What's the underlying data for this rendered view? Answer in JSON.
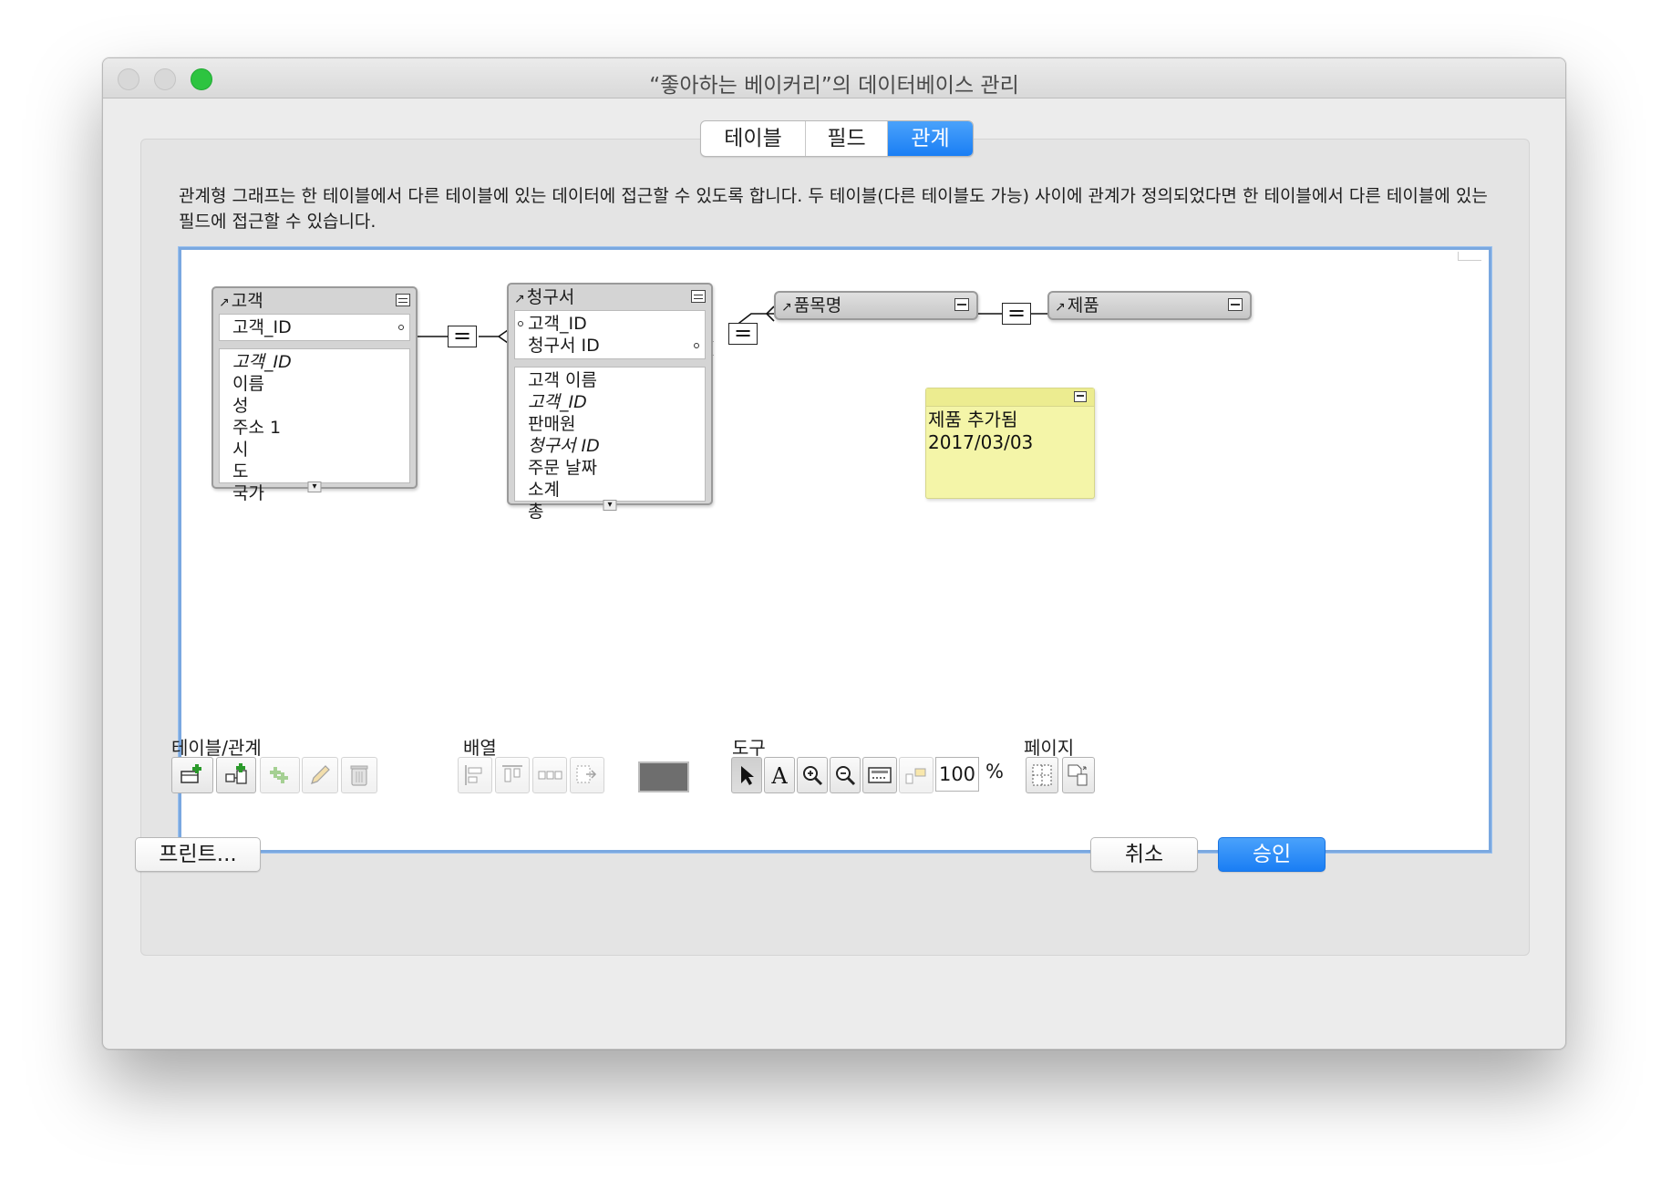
{
  "window": {
    "title": "“좋아하는 베이커리”의 데이터베이스 관리"
  },
  "tabs": [
    {
      "label": "테이블",
      "selected": false
    },
    {
      "label": "필드",
      "selected": false
    },
    {
      "label": "관계",
      "selected": true
    }
  ],
  "description": "관계형 그래프는 한 테이블에서 다른 테이블에 있는 데이터에 접근할 수 있도록 합니다. 두 테이블(다른 테이블도 가능) 사이에 관계가 정의되었다면 한 테이블에서 다른 테이블에 있는 필드에 접근할 수 있습니다.",
  "graph": {
    "tables": [
      {
        "name": "고객",
        "key_fields": [
          "고객_ID"
        ],
        "fields": [
          {
            "label": "고객_ID",
            "italic": true
          },
          {
            "label": "이름",
            "italic": false
          },
          {
            "label": "성",
            "italic": false
          },
          {
            "label": "주소 1",
            "italic": false
          },
          {
            "label": "시",
            "italic": false
          },
          {
            "label": "도",
            "italic": false
          },
          {
            "label": "국가",
            "italic": false
          }
        ]
      },
      {
        "name": "청구서",
        "key_fields": [
          "고객_ID",
          "청구서 ID"
        ],
        "fields": [
          {
            "label": "고객 이름",
            "italic": false
          },
          {
            "label": "고객_ID",
            "italic": true
          },
          {
            "label": "판매원",
            "italic": false
          },
          {
            "label": "청구서 ID",
            "italic": true
          },
          {
            "label": "주문 날짜",
            "italic": false
          },
          {
            "label": "소계",
            "italic": false
          },
          {
            "label": "총",
            "italic": false
          }
        ]
      }
    ],
    "collapsed_tables": [
      {
        "name": "품목명"
      },
      {
        "name": "제품"
      }
    ],
    "note": {
      "lines": [
        "제품 추가됨",
        "2017/03/03"
      ]
    }
  },
  "toolbar": {
    "tables_label": "테이블/관계",
    "arrange_label": "배열",
    "tools_label": "도구",
    "page_label": "페이지",
    "zoom_value": "100",
    "zoom_unit": "%",
    "swatch_color": "#6e6e6e"
  },
  "buttons": {
    "print": "프린트...",
    "cancel": "취소",
    "ok": "승인"
  },
  "colors": {
    "accent": "#1a7ef4",
    "close_button": "#2dc440",
    "note": "#f4f5a8"
  }
}
